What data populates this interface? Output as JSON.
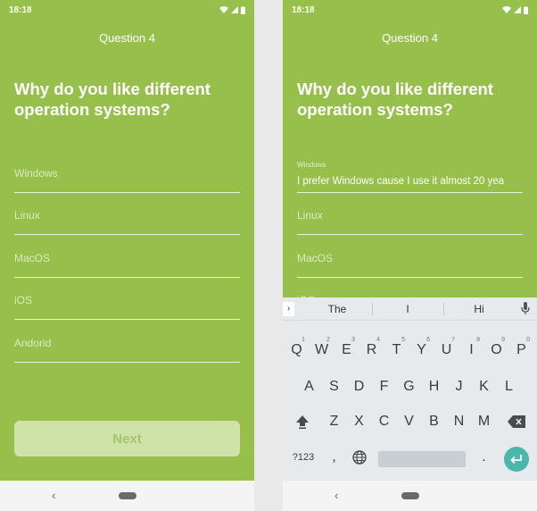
{
  "status": {
    "time": "18:18"
  },
  "question": {
    "label": "Question 4",
    "heading": "Why do you like different operation systems?"
  },
  "left_fields": [
    {
      "placeholder": "Windows"
    },
    {
      "placeholder": "Linux"
    },
    {
      "placeholder": "MacOS"
    },
    {
      "placeholder": "iOS"
    },
    {
      "placeholder": "Andorid"
    }
  ],
  "next_label": "Next",
  "right_fields": {
    "windows_label": "Windows",
    "windows_value": "I prefer Windows cause I use it almost 20 yea",
    "linux": "Linux",
    "macos": "MacOS",
    "ios_partial": "iOS"
  },
  "keyboard": {
    "suggestions": [
      "The",
      "I",
      "Hi"
    ],
    "row1": [
      {
        "k": "Q",
        "n": "1"
      },
      {
        "k": "W",
        "n": "2"
      },
      {
        "k": "E",
        "n": "3"
      },
      {
        "k": "R",
        "n": "4"
      },
      {
        "k": "T",
        "n": "5"
      },
      {
        "k": "Y",
        "n": "6"
      },
      {
        "k": "U",
        "n": "7"
      },
      {
        "k": "I",
        "n": "8"
      },
      {
        "k": "O",
        "n": "9"
      },
      {
        "k": "P",
        "n": "0"
      }
    ],
    "row2": [
      "A",
      "S",
      "D",
      "F",
      "G",
      "H",
      "J",
      "K",
      "L"
    ],
    "row3": [
      "Z",
      "X",
      "C",
      "V",
      "B",
      "N",
      "M"
    ],
    "symbols_label": "?123",
    "comma": ",",
    "period": "."
  },
  "colors": {
    "background": "#97bf4b",
    "button_disabled": "#cfe2a8",
    "enter_key": "#4db6ac"
  },
  "icons": [
    "wifi-icon",
    "signal-icon",
    "battery-icon",
    "back-icon",
    "home-icon",
    "chevron-right-icon",
    "mic-icon",
    "shift-icon",
    "backspace-icon",
    "globe-icon",
    "enter-icon"
  ]
}
